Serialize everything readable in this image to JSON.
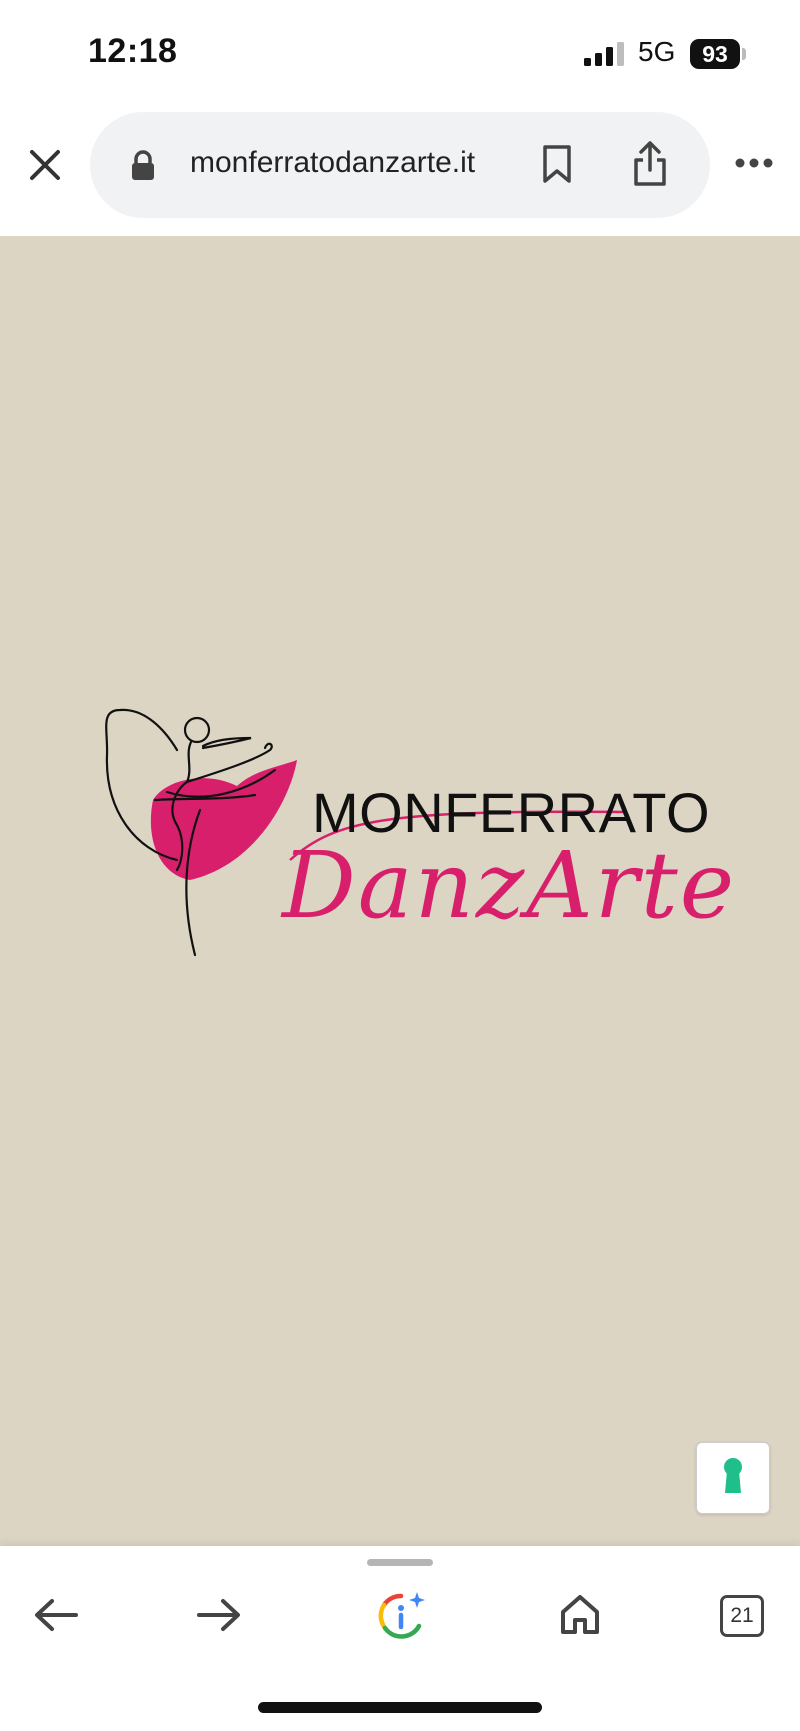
{
  "status_bar": {
    "time": "12:18",
    "network": "5G",
    "battery": "93"
  },
  "browser": {
    "url": "monferratodanzarte.it"
  },
  "logo": {
    "line1": "MONFERRATO",
    "line2": "DanzArte"
  },
  "tabs": {
    "count": "21"
  },
  "colors": {
    "page_background": "#ddd5c4",
    "brand_pink": "#d81f6b",
    "assist_green": "#1fbe8a"
  }
}
